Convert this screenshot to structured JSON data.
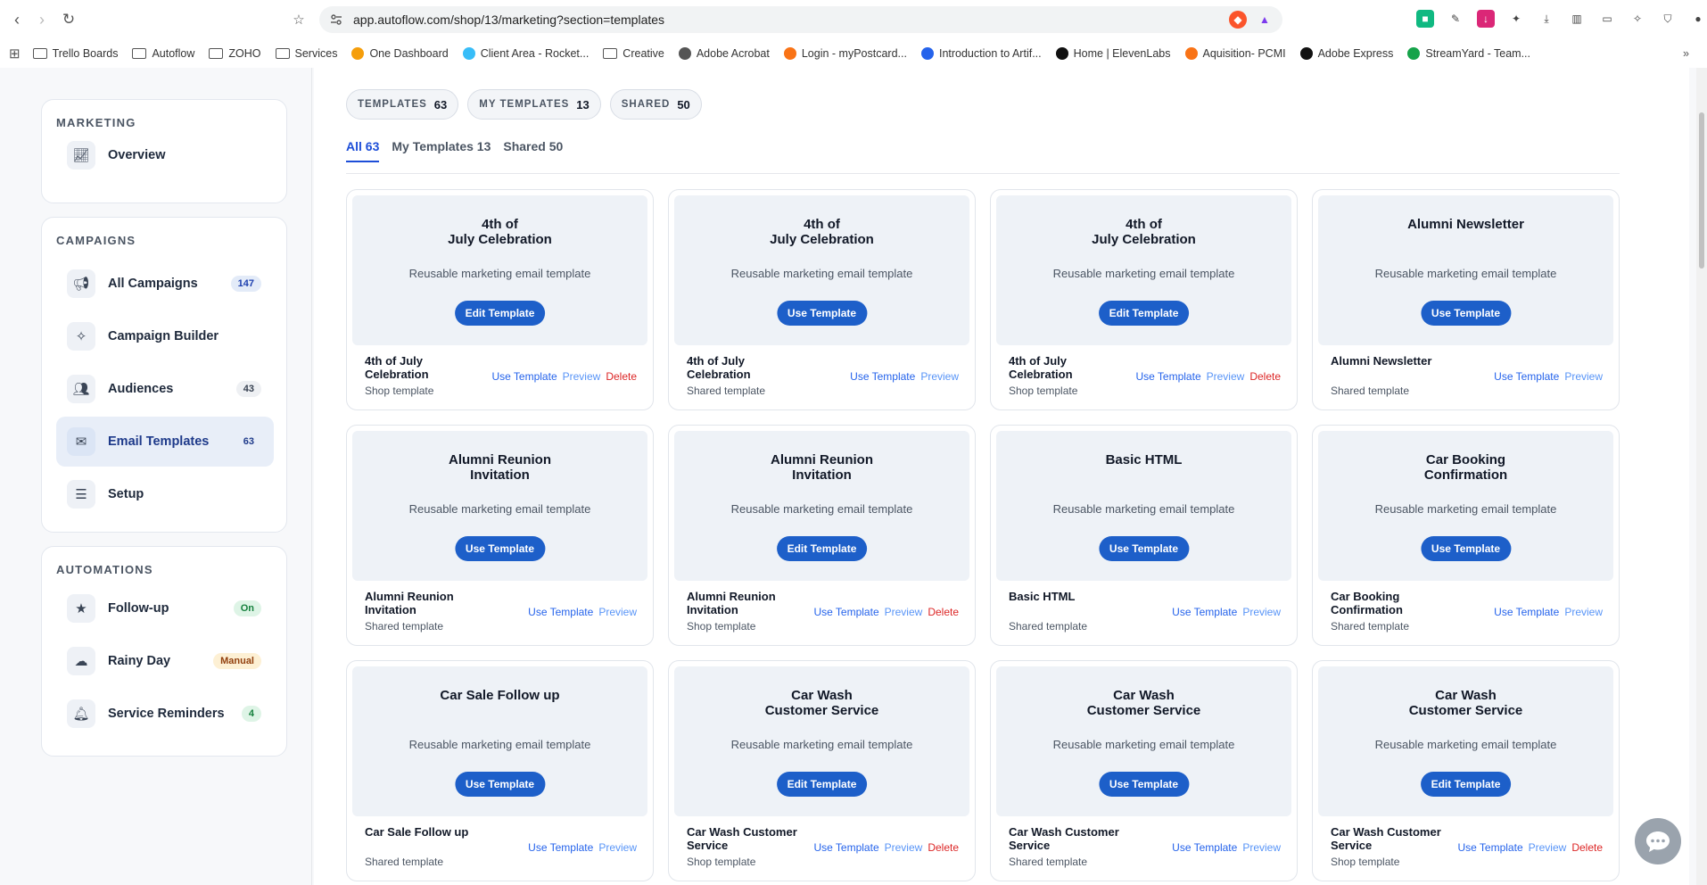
{
  "browser": {
    "url": "app.autoflow.com/shop/13/marketing?section=templates",
    "bookmarks": [
      {
        "label": "Trello Boards",
        "type": "folder"
      },
      {
        "label": "Autoflow",
        "type": "folder"
      },
      {
        "label": "ZOHO",
        "type": "folder"
      },
      {
        "label": "Services",
        "type": "folder"
      },
      {
        "label": "One Dashboard",
        "type": "site",
        "color": "#f59e0b"
      },
      {
        "label": "Client Area - Rocket...",
        "type": "site",
        "color": "#38bdf8"
      },
      {
        "label": "Creative",
        "type": "folder"
      },
      {
        "label": "Adobe Acrobat",
        "type": "site",
        "color": "#555555"
      },
      {
        "label": "Login - myPostcard...",
        "type": "site",
        "color": "#f97316"
      },
      {
        "label": "Introduction to Artif...",
        "type": "site",
        "color": "#2563eb"
      },
      {
        "label": "Home | ElevenLabs",
        "type": "site",
        "color": "#111111"
      },
      {
        "label": "Aquisition- PCMI",
        "type": "site",
        "color": "#f97316"
      },
      {
        "label": "Adobe Express",
        "type": "site",
        "color": "#111111"
      },
      {
        "label": "StreamYard - Team...",
        "type": "site",
        "color": "#16a34a"
      }
    ]
  },
  "sidebar": {
    "sections": [
      {
        "title": "MARKETING",
        "items": [
          {
            "label": "Overview",
            "icon": "chart-line-icon"
          }
        ]
      },
      {
        "title": "CAMPAIGNS",
        "items": [
          {
            "label": "All Campaigns",
            "icon": "megaphone-icon",
            "badge": "147"
          },
          {
            "label": "Campaign Builder",
            "icon": "magic-wand-icon"
          },
          {
            "label": "Audiences",
            "icon": "users-icon",
            "badge": "43"
          },
          {
            "label": "Email Templates",
            "icon": "envelope-icon",
            "badge": "63",
            "active": true
          },
          {
            "label": "Setup",
            "icon": "sliders-icon"
          }
        ]
      },
      {
        "title": "AUTOMATIONS",
        "items": [
          {
            "label": "Follow-up",
            "icon": "star-icon",
            "badge": "On"
          },
          {
            "label": "Rainy Day",
            "icon": "cloud-rain-icon",
            "badge": "Manual"
          },
          {
            "label": "Service Reminders",
            "icon": "bell-icon",
            "badge": "4"
          }
        ]
      }
    ]
  },
  "summary_chips": [
    {
      "label": "TEMPLATES",
      "count": "63"
    },
    {
      "label": "MY TEMPLATES",
      "count": "13"
    },
    {
      "label": "SHARED",
      "count": "50"
    }
  ],
  "tabs": [
    {
      "label": "All 63",
      "active": true
    },
    {
      "label": "My Templates 13"
    },
    {
      "label": "Shared 50"
    }
  ],
  "hero_subtitle": "Reusable marketing email template",
  "templates": [
    {
      "hero_title": "4th of\nJuly Celebration",
      "button": "Edit Template",
      "name": "4th of July Celebration",
      "type": "Shop template",
      "actions": [
        "Use Template",
        "Preview",
        "Delete"
      ]
    },
    {
      "hero_title": "4th of\nJuly Celebration",
      "button": "Use Template",
      "name": "4th of July Celebration",
      "type": "Shared template",
      "actions": [
        "Use Template",
        "Preview"
      ]
    },
    {
      "hero_title": "4th of\nJuly Celebration",
      "button": "Edit Template",
      "name": "4th of July Celebration",
      "type": "Shop template",
      "actions": [
        "Use Template",
        "Preview",
        "Delete"
      ]
    },
    {
      "hero_title": "Alumni Newsletter",
      "button": "Use Template",
      "name": "Alumni Newsletter",
      "type": "Shared template",
      "actions": [
        "Use Template",
        "Preview"
      ]
    },
    {
      "hero_title": "Alumni Reunion\nInvitation",
      "button": "Use Template",
      "name": "Alumni Reunion Invitation",
      "type": "Shared template",
      "actions": [
        "Use Template",
        "Preview"
      ]
    },
    {
      "hero_title": "Alumni Reunion\nInvitation",
      "button": "Edit Template",
      "name": "Alumni Reunion Invitation",
      "type": "Shop template",
      "actions": [
        "Use Template",
        "Preview",
        "Delete"
      ]
    },
    {
      "hero_title": "Basic HTML",
      "button": "Use Template",
      "name": "Basic HTML",
      "type": "Shared template",
      "actions": [
        "Use Template",
        "Preview"
      ]
    },
    {
      "hero_title": "Car Booking\nConfirmation",
      "button": "Use Template",
      "name": "Car Booking Confirmation",
      "type": "Shared template",
      "actions": [
        "Use Template",
        "Preview"
      ]
    },
    {
      "hero_title": "Car Sale Follow up",
      "button": "Use Template",
      "name": "Car Sale Follow up",
      "type": "Shared template",
      "actions": [
        "Use Template",
        "Preview"
      ]
    },
    {
      "hero_title": "Car Wash\nCustomer Service",
      "button": "Edit Template",
      "name": "Car Wash Customer Service",
      "type": "Shop template",
      "actions": [
        "Use Template",
        "Preview",
        "Delete"
      ]
    },
    {
      "hero_title": "Car Wash\nCustomer Service",
      "button": "Use Template",
      "name": "Car Wash Customer Service",
      "type": "Shared template",
      "actions": [
        "Use Template",
        "Preview"
      ]
    },
    {
      "hero_title": "Car Wash\nCustomer Service",
      "button": "Edit Template",
      "name": "Car Wash Customer Service",
      "type": "Shop template",
      "actions": [
        "Use Template",
        "Preview",
        "Delete"
      ]
    }
  ]
}
